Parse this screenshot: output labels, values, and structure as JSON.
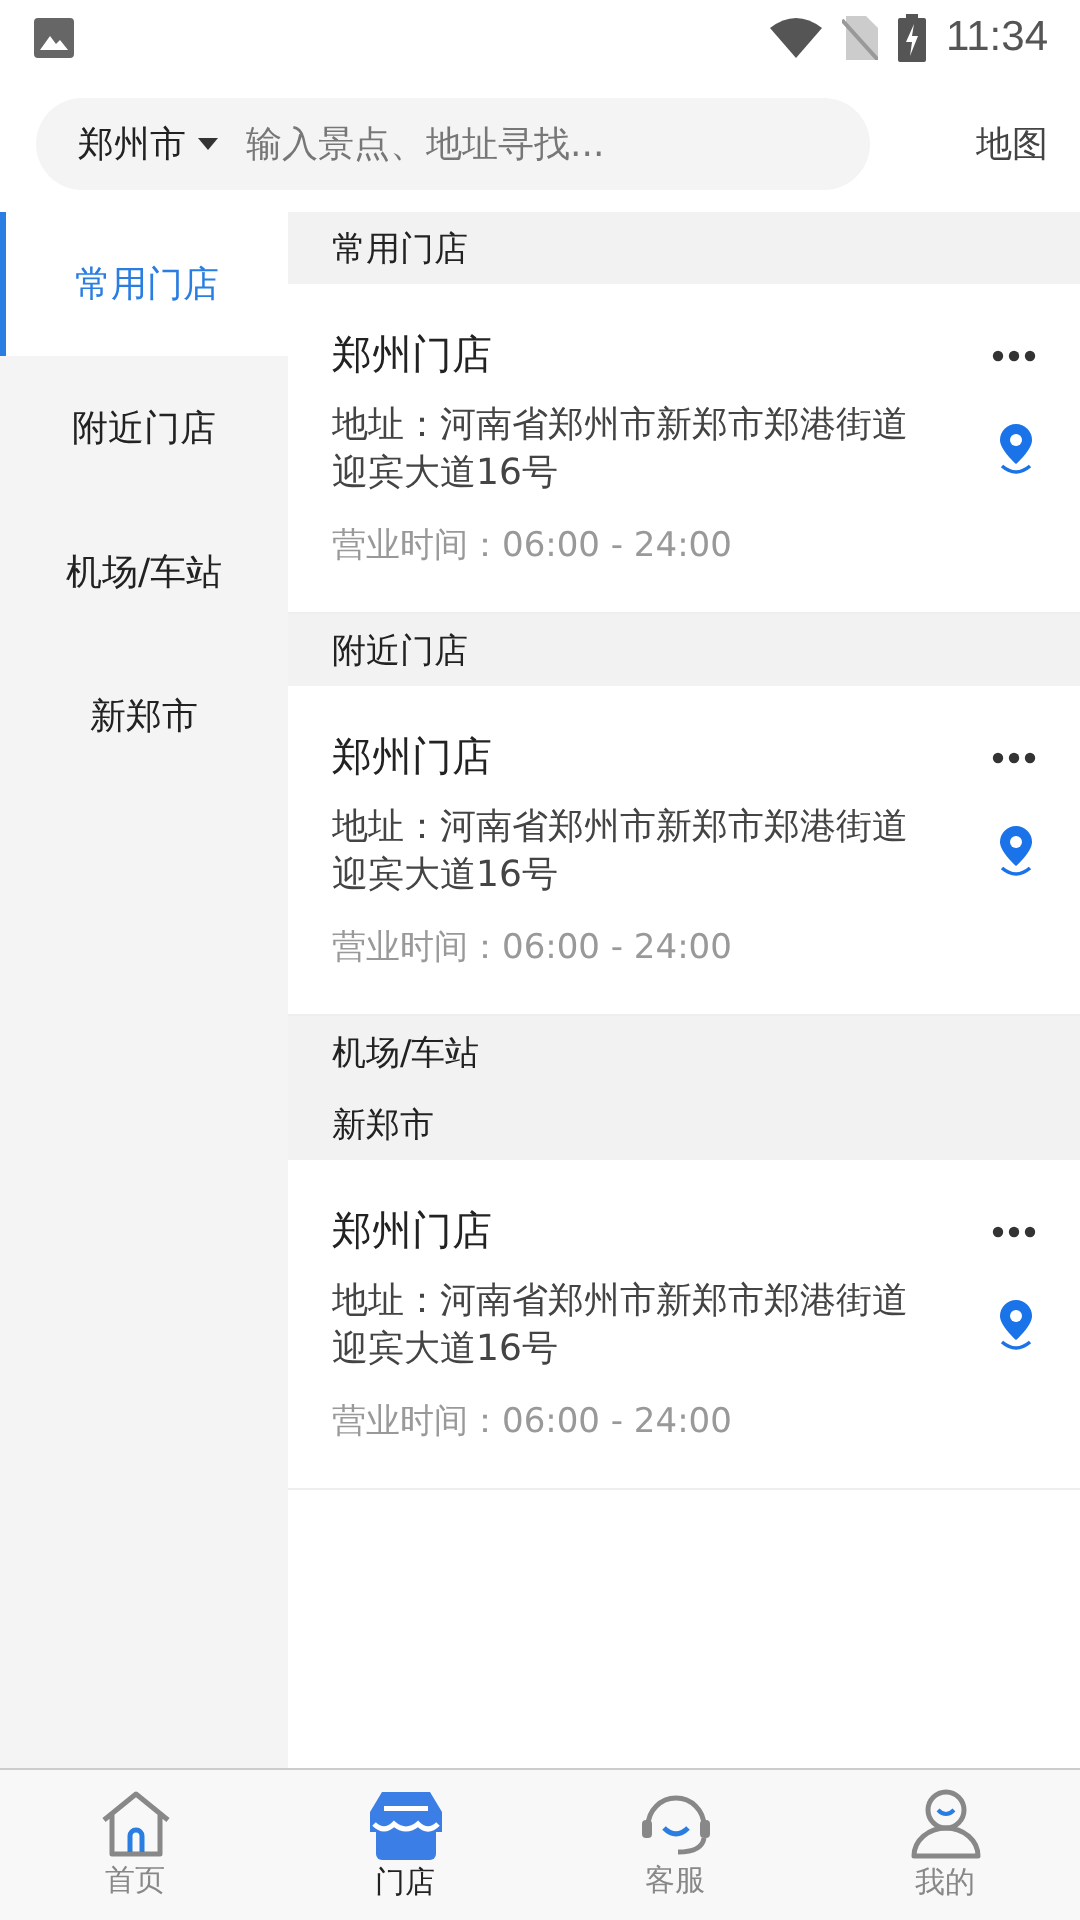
{
  "status_bar": {
    "time": "11:34"
  },
  "search": {
    "city": "郑州市",
    "placeholder": "输入景点、地址寻找...",
    "map_link": "地图"
  },
  "sidebar": {
    "items": [
      {
        "label": "常用门店",
        "selected": true
      },
      {
        "label": "附近门店",
        "selected": false
      },
      {
        "label": "机场/车站",
        "selected": false
      },
      {
        "label": "新郑市",
        "selected": false
      }
    ]
  },
  "sections": [
    {
      "title": "常用门店",
      "stores": [
        {
          "name": "郑州门店",
          "address": "地址：河南省郑州市新郑市郑港街道迎宾大道16号",
          "hours": "营业时间：06:00 - 24:00"
        }
      ]
    },
    {
      "title": "附近门店",
      "stores": [
        {
          "name": "郑州门店",
          "address": "地址：河南省郑州市新郑市郑港街道迎宾大道16号",
          "hours": "营业时间：06:00 - 24:00"
        }
      ]
    },
    {
      "title": "机场/车站"
    },
    {
      "title": "新郑市",
      "stores": [
        {
          "name": "郑州门店",
          "address": "地址：河南省郑州市新郑市郑港街道迎宾大道16号",
          "hours": "营业时间：06:00 - 24:00"
        }
      ]
    }
  ],
  "tab_bar": [
    {
      "label": "首页",
      "kind": "home",
      "selected": false
    },
    {
      "label": "门店",
      "kind": "store",
      "selected": true
    },
    {
      "label": "客服",
      "kind": "service",
      "selected": false
    },
    {
      "label": "我的",
      "kind": "profile",
      "selected": false
    }
  ]
}
